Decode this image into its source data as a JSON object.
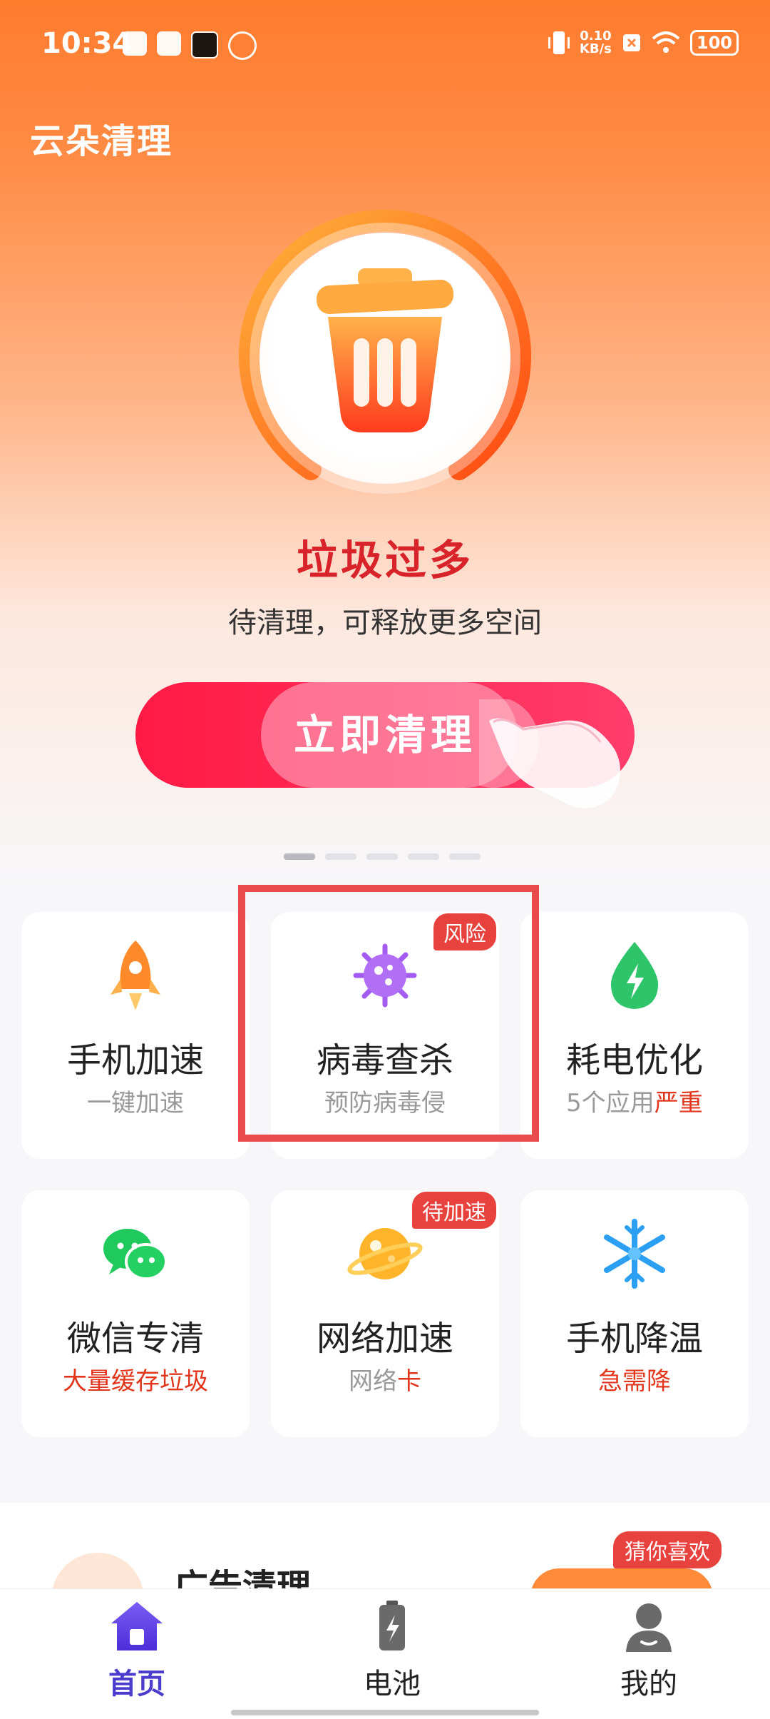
{
  "status_bar": {
    "time": "10:34",
    "net_speed_value": "0.10",
    "net_speed_unit": "KB/s",
    "battery": "100"
  },
  "app": {
    "title": "云朵清理"
  },
  "clean_status": {
    "title": "垃圾过多",
    "subtitle": "待清理，可释放更多空间",
    "button_label": "立即清理"
  },
  "features": [
    {
      "title": "手机加速",
      "subtitle": "一键加速",
      "badge": "",
      "icon": "rocket-icon"
    },
    {
      "title": "病毒查杀",
      "subtitle": "预防病毒侵",
      "badge": "风险",
      "icon": "virus-icon"
    },
    {
      "title": "耗电优化",
      "subtitle_prefix": "5个应用",
      "subtitle_warn": "严重",
      "badge": "",
      "icon": "battery-drop-icon"
    },
    {
      "title": "微信专清",
      "subtitle": "大量缓存垃圾",
      "badge": "",
      "icon": "wechat-icon"
    },
    {
      "title": "网络加速",
      "subtitle_prefix": "网络",
      "subtitle_warn": "卡",
      "badge": "待加速",
      "icon": "planet-icon"
    },
    {
      "title": "手机降温",
      "subtitle": "急需降",
      "badge": "",
      "icon": "snowflake-icon"
    }
  ],
  "ad_section": {
    "title": "广告清理",
    "badge": "猜你喜欢"
  },
  "tabs": [
    {
      "label": "首页",
      "active": true,
      "icon": "home-icon"
    },
    {
      "label": "电池",
      "active": false,
      "icon": "battery-icon"
    },
    {
      "label": "我的",
      "active": false,
      "icon": "profile-icon"
    }
  ],
  "colors": {
    "brand_orange": "#ff7b2e",
    "alert_red": "#d8232a",
    "button_red": "#ff1a45",
    "tab_active": "#4b3ccd"
  }
}
